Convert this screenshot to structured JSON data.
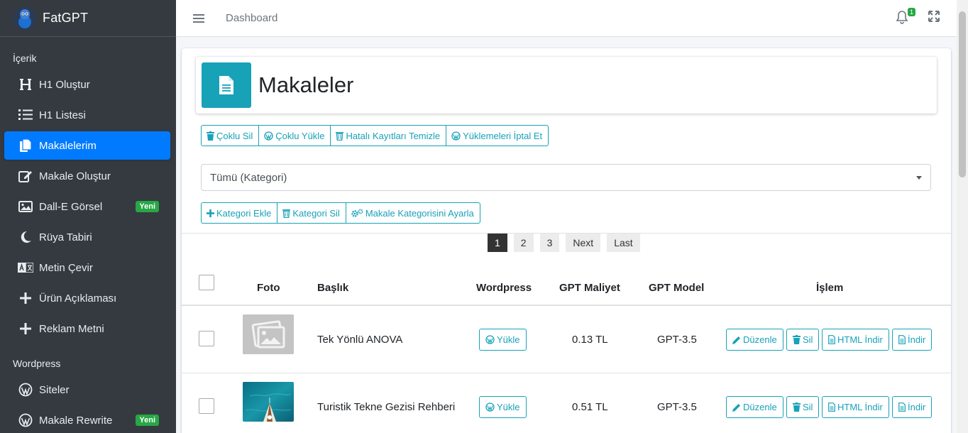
{
  "brand": {
    "name": "FatGPT"
  },
  "sidebar": {
    "sections": [
      {
        "header": "İçerik"
      },
      {
        "header": "Wordpress"
      }
    ],
    "items": [
      {
        "label": "H1 Oluştur",
        "icon": "heading-icon"
      },
      {
        "label": "H1 Listesi",
        "icon": "list-ol-icon"
      },
      {
        "label": "Makalelerim",
        "icon": "copy-icon",
        "active": true
      },
      {
        "label": "Makale Oluştur",
        "icon": "edit-icon"
      },
      {
        "label": "Dall-E Görsel",
        "icon": "image-icon",
        "badge": "Yeni"
      },
      {
        "label": "Rüya Tabiri",
        "icon": "moon-icon"
      },
      {
        "label": "Metin Çevir",
        "icon": "language-icon"
      },
      {
        "label": "Ürün Açıklaması",
        "icon": "plus-icon"
      },
      {
        "label": "Reklam Metni",
        "icon": "plus-icon"
      },
      {
        "label": "Siteler",
        "icon": "wordpress-icon"
      },
      {
        "label": "Makale Rewrite",
        "icon": "wordpress-icon",
        "badge": "Yeni"
      }
    ]
  },
  "topbar": {
    "breadcrumb": "Dashboard",
    "notification_count": "1"
  },
  "page": {
    "title": "Makaleler"
  },
  "actions": {
    "bulk_delete": "Çoklu Sil",
    "bulk_upload": "Çoklu Yükle",
    "clean_errors": "Hatalı Kayıtları Temizle",
    "cancel_uploads": "Yüklemeleri İptal Et"
  },
  "category_select": {
    "selected": "Tümü (Kategori)"
  },
  "category_actions": {
    "add": "Kategori Ekle",
    "delete": "Kategori Sil",
    "assign": "Makale Kategorisini Ayarla"
  },
  "pagination": {
    "pages": [
      "1",
      "2",
      "3"
    ],
    "current": "1",
    "next": "Next",
    "last": "Last"
  },
  "table": {
    "headers": {
      "photo": "Foto",
      "title": "Başlık",
      "wordpress": "Wordpress",
      "cost": "GPT Maliyet",
      "model": "GPT Model",
      "actions": "İşlem"
    },
    "rows": [
      {
        "title": "Tek Yönlü ANOVA",
        "upload": "Yükle",
        "cost": "0.13 TL",
        "model": "GPT-3.5",
        "edit": "Düzenle",
        "delete": "Sil",
        "html_download": "HTML İndir",
        "download": "İndir"
      },
      {
        "title": "Turistik Tekne Gezisi Rehberi",
        "upload": "Yükle",
        "cost": "0.51 TL",
        "model": "GPT-3.5",
        "edit": "Düzenle",
        "delete": "Sil",
        "html_download": "HTML İndir",
        "download": "İndir"
      }
    ]
  },
  "colors": {
    "sidebar_bg": "#343a40",
    "active": "#007bff",
    "accent": "#17a2b8",
    "badge": "#28a745"
  }
}
